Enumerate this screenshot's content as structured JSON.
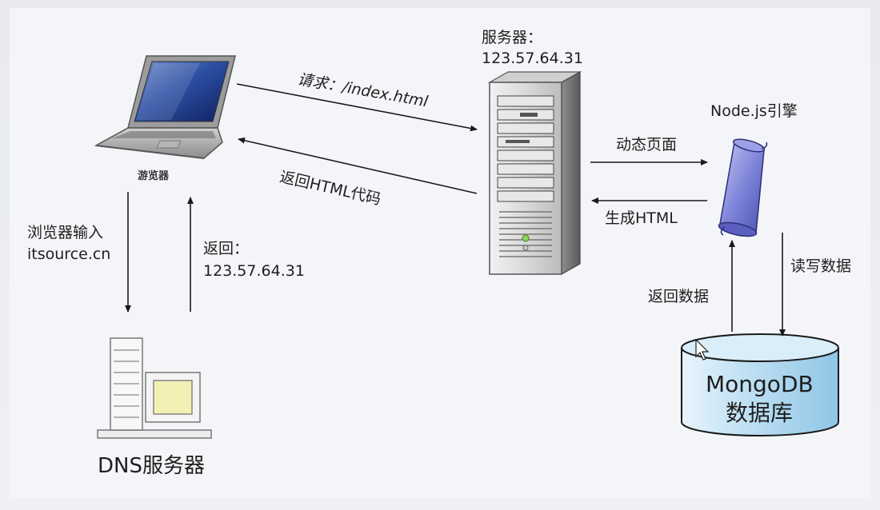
{
  "browser": {
    "label": "游览器"
  },
  "server": {
    "title": "服务器：",
    "ip": "123.57.64.31"
  },
  "request": {
    "label": "请求：/index.html"
  },
  "response": {
    "label": "返回HTML代码"
  },
  "node": {
    "label": "Node.js引擎"
  },
  "dynamic_page": {
    "label": "动态页面"
  },
  "generate_html": {
    "label": "生成HTML"
  },
  "browser_input": {
    "line1": "浏览器输入",
    "line2": "itsource.cn"
  },
  "dns_return": {
    "line1": "返回：",
    "line2": "123.57.64.31"
  },
  "dns": {
    "label": "DNS服务器"
  },
  "db_return": {
    "label": "返回数据"
  },
  "db_rw": {
    "label": "读写数据"
  },
  "mongodb": {
    "line1": "MongoDB",
    "line2": "数据库"
  }
}
